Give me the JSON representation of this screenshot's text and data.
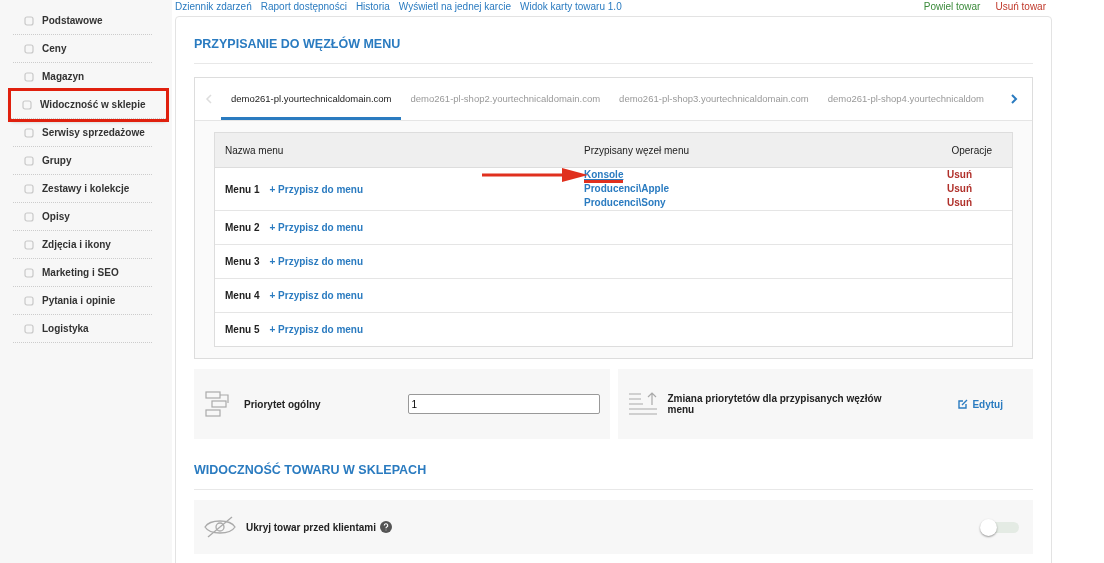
{
  "sidebar": {
    "items": [
      {
        "label": "Podstawowe",
        "highlighted": false
      },
      {
        "label": "Ceny",
        "highlighted": false
      },
      {
        "label": "Magazyn",
        "highlighted": false
      },
      {
        "label": "Widoczność w sklepie",
        "highlighted": true
      },
      {
        "label": "Serwisy sprzedażowe",
        "highlighted": false
      },
      {
        "label": "Grupy",
        "highlighted": false
      },
      {
        "label": "Zestawy i kolekcje",
        "highlighted": false
      },
      {
        "label": "Opisy",
        "highlighted": false
      },
      {
        "label": "Zdjęcia i ikony",
        "highlighted": false
      },
      {
        "label": "Marketing i SEO",
        "highlighted": false
      },
      {
        "label": "Pytania i opinie",
        "highlighted": false
      },
      {
        "label": "Logistyka",
        "highlighted": false
      }
    ]
  },
  "top_links": [
    "Dziennik zdarzeń",
    "Raport dostępności",
    "Historia",
    "Wyświetl na jednej karcie",
    "Widok karty towaru 1.0"
  ],
  "top_actions": [
    {
      "label": "Powiel towar",
      "kind": "copy"
    },
    {
      "label": "Usuń towar",
      "kind": "delete"
    }
  ],
  "menu_section": {
    "title": "PRZYPISANIE DO WĘZŁÓW MENU",
    "tabs": [
      {
        "label": "demo261-pl.yourtechnicaldomain.com",
        "selected": true
      },
      {
        "label": "demo261-pl-shop2.yourtechnicaldomain.com",
        "selected": false
      },
      {
        "label": "demo261-pl-shop3.yourtechnicaldomain.com",
        "selected": false
      },
      {
        "label": "demo261-pl-shop4.yourtechnicaldom",
        "selected": false
      }
    ],
    "columns": [
      "Nazwa menu",
      "Przypisany węzeł menu",
      "Operacje"
    ],
    "rows": [
      {
        "name": "Menu 1",
        "assign": "+ Przypisz do menu",
        "nodes": [
          {
            "label": "Konsole",
            "remove": "Usuń",
            "annotated": true
          },
          {
            "label": "Producenci\\Apple",
            "remove": "Usuń",
            "annotated": false
          },
          {
            "label": "Producenci\\Sony",
            "remove": "Usuń",
            "annotated": false
          }
        ]
      },
      {
        "name": "Menu 2",
        "assign": "+ Przypisz do menu",
        "nodes": []
      },
      {
        "name": "Menu 3",
        "assign": "+ Przypisz do menu",
        "nodes": []
      },
      {
        "name": "Menu 4",
        "assign": "+ Przypisz do menu",
        "nodes": []
      },
      {
        "name": "Menu 5",
        "assign": "+ Przypisz do menu",
        "nodes": []
      }
    ]
  },
  "priority": {
    "label": "Priorytet ogólny",
    "value": "1"
  },
  "priority_change": {
    "label": "Zmiana priorytetów dla przypisanych węzłów menu",
    "action": "Edytuj"
  },
  "visibility_section": {
    "title": "WIDOCZNOŚĆ TOWARU W SKLEPACH",
    "hide_label": "Ukryj towar przed klientami",
    "hide_on": false
  }
}
